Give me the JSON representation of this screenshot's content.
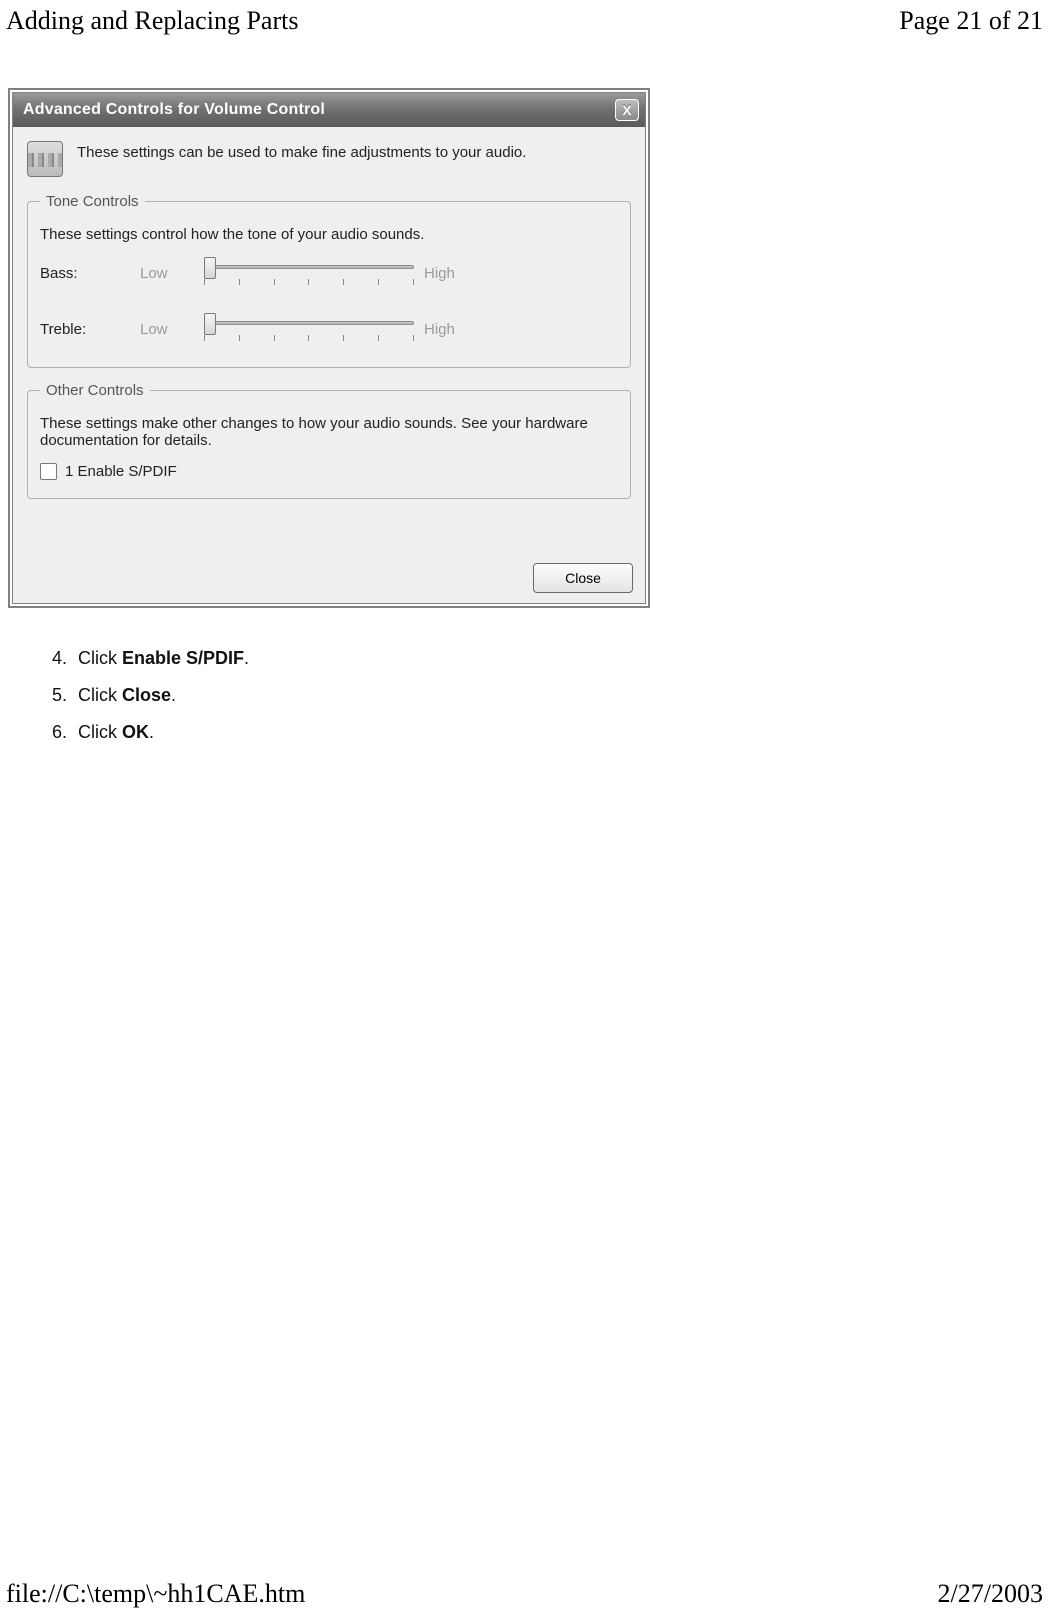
{
  "page_header": {
    "left": "Adding and Replacing Parts",
    "right": "Page 21 of 21"
  },
  "page_footer": {
    "left": "file://C:\\temp\\~hh1CAE.htm",
    "right": "2/27/2003"
  },
  "dialog": {
    "title": "Advanced Controls for Volume Control",
    "close_symbol": "X",
    "intro": "These settings can be used to make fine adjustments to your audio.",
    "tone": {
      "legend": "Tone Controls",
      "desc": "These settings control how the tone of your audio sounds.",
      "bass_label": "Bass:",
      "treble_label": "Treble:",
      "low": "Low",
      "high": "High"
    },
    "other": {
      "legend": "Other Controls",
      "desc": "These settings make other changes to how your audio sounds.  See your hardware documentation for details.",
      "checkbox_label": "1  Enable S/PDIF"
    },
    "close_button": "Close"
  },
  "steps": {
    "start": 4,
    "items": [
      {
        "prefix": "Click ",
        "bold": "Enable S/PDIF",
        "suffix": "."
      },
      {
        "prefix": "Click ",
        "bold": "Close",
        "suffix": "."
      },
      {
        "prefix": "Click ",
        "bold": "OK",
        "suffix": "."
      }
    ]
  }
}
